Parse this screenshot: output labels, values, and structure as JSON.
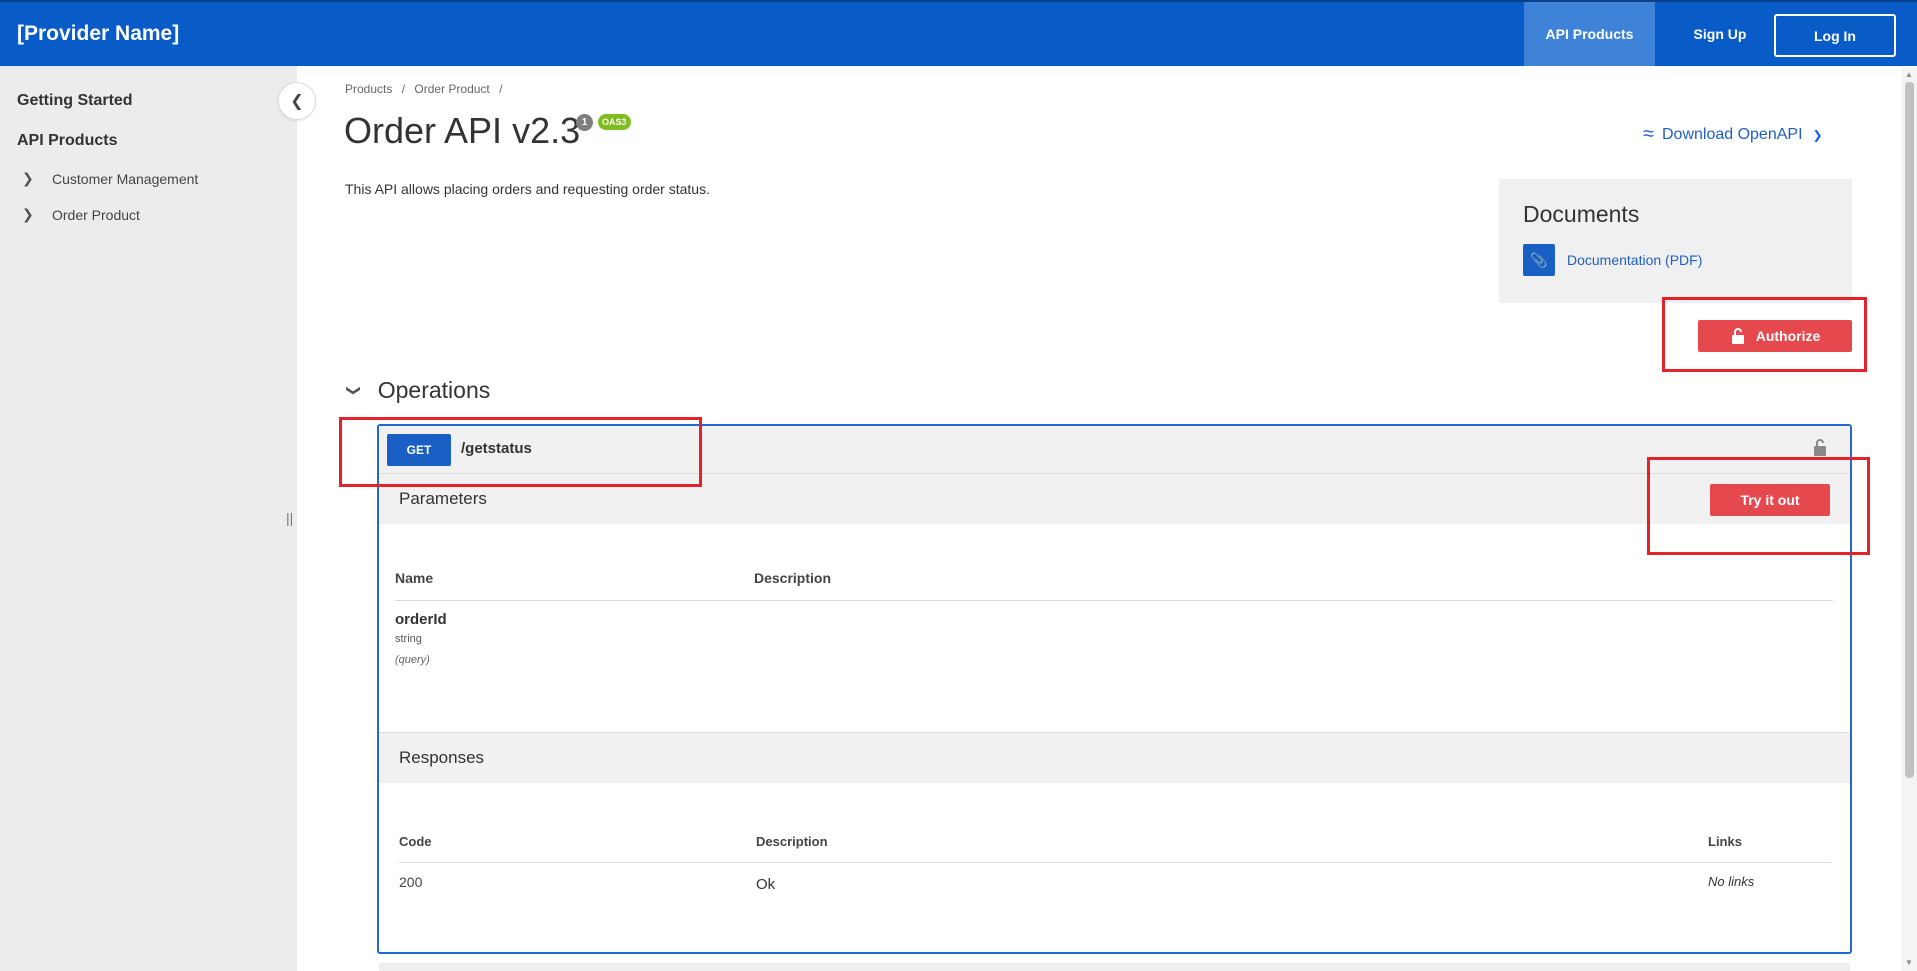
{
  "header": {
    "brand": "[Provider Name]",
    "nav_api_products": "API Products",
    "nav_signup": "Sign Up",
    "nav_login": "Log In",
    "bg_color": "#095bc8"
  },
  "sidebar": {
    "getting_started": "Getting Started",
    "api_products": "API Products",
    "items": [
      {
        "label": "Customer Management"
      },
      {
        "label": "Order Product"
      }
    ]
  },
  "breadcrumb": {
    "items": [
      "Products",
      "/",
      "Order Product",
      "/"
    ]
  },
  "page": {
    "title": "Order API v2.3",
    "version_badge": "1",
    "spec_badge": "OAS3",
    "download": "Download OpenAPI",
    "description": "This API allows placing orders and requesting order status."
  },
  "documents": {
    "title": "Documents",
    "link": "Documentation (PDF)"
  },
  "authorize": {
    "label": "Authorize",
    "color": "#e5484d"
  },
  "operations": {
    "title": "Operations",
    "method": "GET",
    "path": "/getstatus",
    "parameters_title": "Parameters",
    "try_it_out": "Try it out",
    "param_headers": {
      "name": "Name",
      "description": "Description"
    },
    "params": [
      {
        "name": "orderId",
        "type": "string",
        "in": "(query)"
      }
    ],
    "responses_title": "Responses",
    "response_headers": {
      "code": "Code",
      "description": "Description",
      "links": "Links"
    },
    "responses": [
      {
        "code": "200",
        "description": "Ok",
        "links": "No links"
      }
    ]
  }
}
